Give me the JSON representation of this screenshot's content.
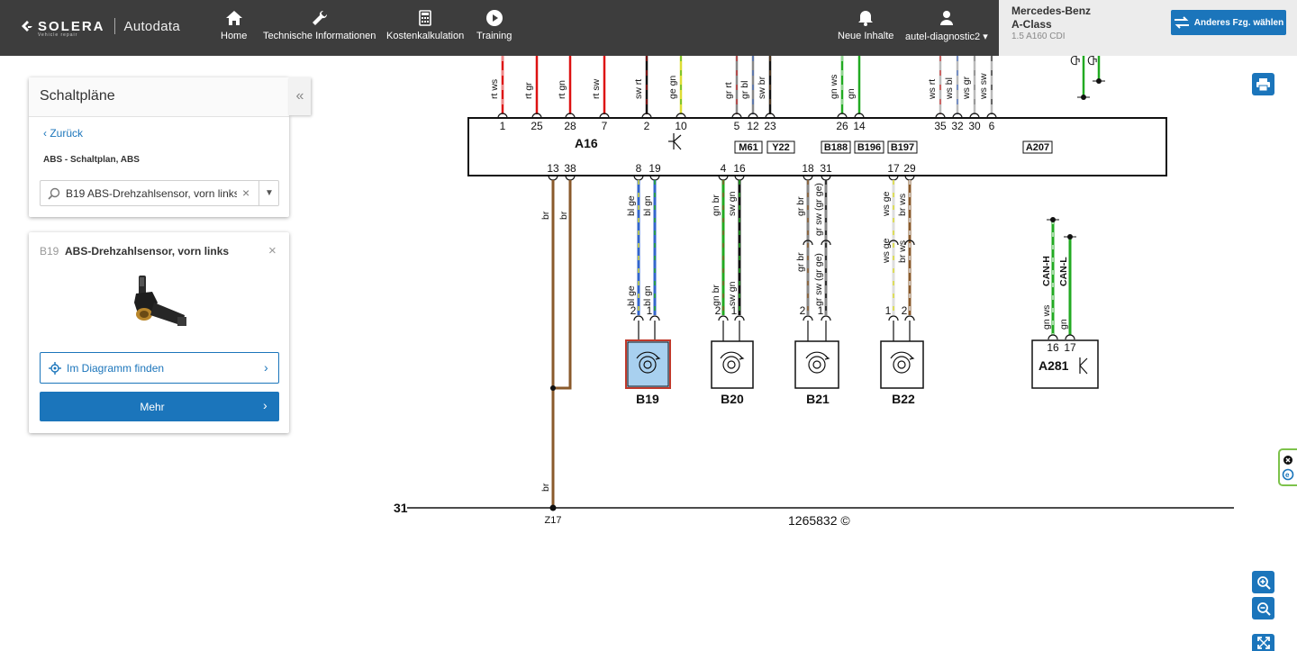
{
  "brand": {
    "name": "SOLERA",
    "tagline": "Vehicle repair",
    "product": "Autodata"
  },
  "nav": [
    {
      "label": "Home",
      "icon": "home-icon"
    },
    {
      "label": "Technische Informationen",
      "icon": "wrench-icon"
    },
    {
      "label": "Kostenkalkulation",
      "icon": "calculator-icon"
    },
    {
      "label": "Training",
      "icon": "play-icon"
    },
    {
      "label": "Neue Inhalte",
      "icon": "bell-icon"
    },
    {
      "label": "autel-diagnostic2",
      "icon": "user-icon"
    }
  ],
  "vehicle": {
    "make": "Mercedes-Benz",
    "model": "A-Class",
    "engine": "1.5 A160 CDI",
    "change_label": "Anderes Fzg. wählen"
  },
  "schaltplaene": {
    "title": "Schaltpläne",
    "back_label": "Zurück",
    "breadcrumb": "ABS - Schaltplan, ABS",
    "search_value": "B19 ABS-Drehzahlsensor, vorn links"
  },
  "component": {
    "code": "B19",
    "name": "ABS-Drehzahlsensor, vorn links",
    "find_label": "Im Diagramm finden",
    "more_label": "Mehr"
  },
  "colors": {
    "topbar": "#3d3d3d",
    "accent": "#1b75bb",
    "highlight_fill": "#a8d0ef",
    "highlight_border": "#c0392b"
  },
  "diagram": {
    "main_module": "A16",
    "ground_label": "31",
    "ground_point": "Z17",
    "diagram_id": "1265832 ©",
    "top_pins": [
      "1",
      "25",
      "28",
      "7",
      "2",
      "10",
      "5",
      "12",
      "23",
      "26",
      "14",
      "35",
      "32",
      "30",
      "6"
    ],
    "top_wires": [
      "rt ws",
      "rt gr",
      "rt gn",
      "rt sw",
      "sw rt",
      "ge gn",
      "gr rt",
      "gr bl",
      "sw br",
      "gn ws",
      "gn",
      "ws rt",
      "ws bl",
      "ws gr",
      "ws sw"
    ],
    "module_tags": [
      "M61",
      "Y22",
      "B188",
      "B196",
      "B197",
      "A207"
    ],
    "bottom_pins": [
      "13",
      "38",
      "8",
      "19",
      "4",
      "16",
      "18",
      "31",
      "17",
      "29"
    ],
    "ground_wires": [
      "br",
      "br",
      "br"
    ],
    "sensor_wires_upper": [
      "bl ge",
      "bl gn",
      "gn br",
      "sw gn",
      "gr br",
      "gr sw (gr ge)",
      "ws ge",
      "br ws"
    ],
    "sensor_wires_lower": [
      "bl ge",
      "bl gn",
      "gn br",
      "sw gn",
      "gr br",
      "gr sw (gr ge)",
      "ws ge",
      "br ws"
    ],
    "sensors": [
      {
        "code": "B19",
        "pins": [
          "2",
          "1"
        ]
      },
      {
        "code": "B20",
        "pins": [
          "2",
          "1"
        ]
      },
      {
        "code": "B21",
        "pins": [
          "2",
          "1"
        ]
      },
      {
        "code": "B22",
        "pins": [
          "1",
          "2"
        ]
      }
    ],
    "can_module": {
      "code": "A281",
      "pins": [
        "16",
        "17"
      ],
      "bus_labels": [
        "CAN-H",
        "CAN-L"
      ],
      "wires": [
        "gn ws",
        "gn"
      ]
    }
  }
}
